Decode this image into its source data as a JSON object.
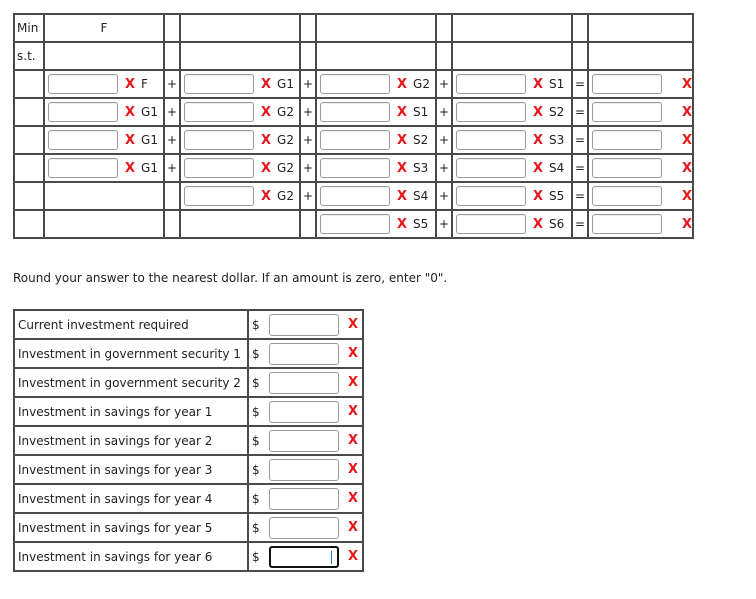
{
  "lp_table": {
    "objective_label": "Min",
    "objective_header": "F",
    "constraints_label": "s.t.",
    "wrong_mark": "X",
    "rows": [
      {
        "terms": [
          {
            "var": "F"
          },
          {
            "var": "G1"
          },
          {
            "var": "G2"
          },
          {
            "var": "S1"
          }
        ],
        "ops": [
          "+",
          "+",
          "+",
          "="
        ]
      },
      {
        "terms": [
          {
            "var": "G1"
          },
          {
            "var": "G2"
          },
          {
            "var": "S1"
          },
          {
            "var": "S2"
          }
        ],
        "ops": [
          "+",
          "+",
          "+",
          "="
        ]
      },
      {
        "terms": [
          {
            "var": "G1"
          },
          {
            "var": "G2"
          },
          {
            "var": "S2"
          },
          {
            "var": "S3"
          }
        ],
        "ops": [
          "+",
          "+",
          "+",
          "="
        ]
      },
      {
        "terms": [
          {
            "var": "G1"
          },
          {
            "var": "G2"
          },
          {
            "var": "S3"
          },
          {
            "var": "S4"
          }
        ],
        "ops": [
          "+",
          "+",
          "+",
          "="
        ]
      },
      {
        "terms": [
          null,
          {
            "var": "G2"
          },
          {
            "var": "S4"
          },
          {
            "var": "S5"
          }
        ],
        "ops": [
          "",
          "+",
          "+",
          "="
        ]
      },
      {
        "terms": [
          null,
          null,
          {
            "var": "S5"
          },
          {
            "var": "S6"
          }
        ],
        "ops": [
          "",
          "",
          "+",
          "="
        ]
      }
    ]
  },
  "instruction": "Round your answer to the nearest dollar. If an amount is zero, enter \"0\".",
  "answers": {
    "currency": "$",
    "wrong_mark": "X",
    "rows": [
      {
        "label": "Current investment required",
        "value": ""
      },
      {
        "label": "Investment in government security 1",
        "value": ""
      },
      {
        "label": "Investment in government security 2",
        "value": ""
      },
      {
        "label": "Investment in savings for year 1",
        "value": ""
      },
      {
        "label": "Investment in savings for year 2",
        "value": ""
      },
      {
        "label": "Investment in savings for year 3",
        "value": ""
      },
      {
        "label": "Investment in savings for year 4",
        "value": ""
      },
      {
        "label": "Investment in savings for year 5",
        "value": ""
      },
      {
        "label": "Investment in savings for year 6",
        "value": "",
        "focused": true
      }
    ]
  },
  "colors": {
    "wrong": "#e8161a",
    "border": "#4a4a4a",
    "focus_caret": "#2a7bd0"
  }
}
